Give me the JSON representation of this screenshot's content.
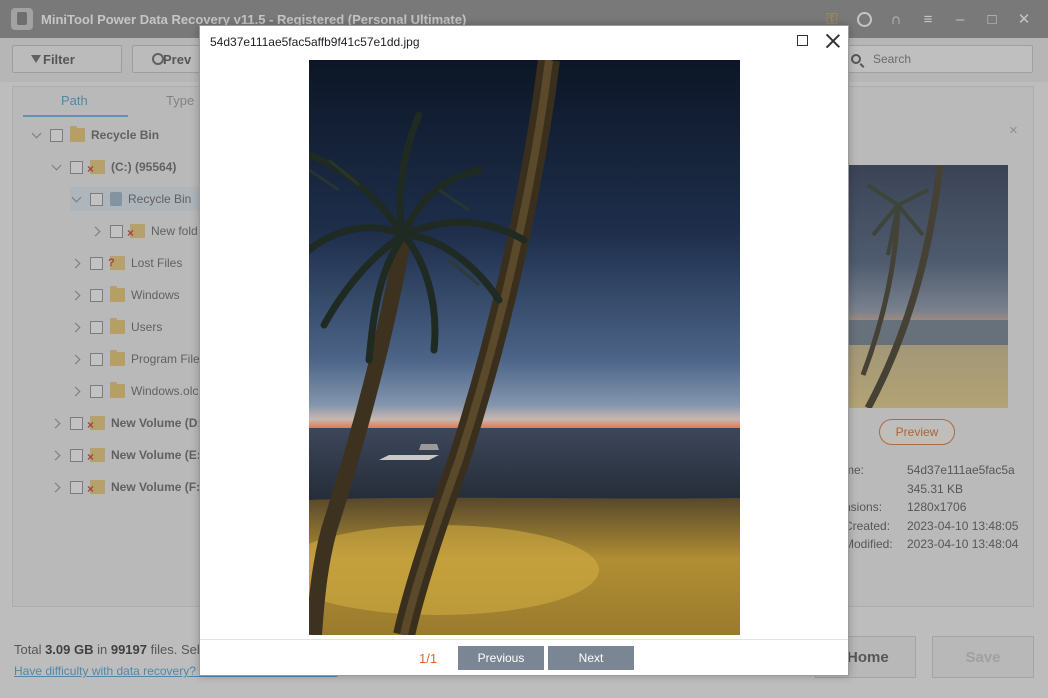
{
  "app": {
    "title": "MiniTool Power Data Recovery v11.5 - Registered (Personal Ultimate)"
  },
  "toolbar": {
    "filter_label": "Filter",
    "preview_label": "Prev",
    "search_placeholder": "Search"
  },
  "tabs": {
    "path": "Path",
    "type": "Type"
  },
  "tree": [
    {
      "label": "Recycle Bin",
      "icon": "folder-icon"
    },
    {
      "label": "(C:) (95564)",
      "icon": "drive-icon"
    },
    {
      "label": "Recycle Bin",
      "icon": "recycle-bin-icon"
    },
    {
      "label": "New fold",
      "icon": "drive-icon"
    },
    {
      "label": "Lost Files",
      "icon": "question-icon"
    },
    {
      "label": "Windows",
      "icon": "folder-icon"
    },
    {
      "label": "Users",
      "icon": "folder-icon"
    },
    {
      "label": "Program File",
      "icon": "folder-icon"
    },
    {
      "label": "Windows.olc",
      "icon": "folder-icon"
    },
    {
      "label": "New Volume (D:",
      "icon": "drive-icon"
    },
    {
      "label": "New Volume (E:)",
      "icon": "drive-icon"
    },
    {
      "label": "New Volume (F:)",
      "icon": "drive-icon"
    }
  ],
  "detail": {
    "close": "×",
    "preview_label": "Preview",
    "rows": [
      {
        "label": "me:",
        "value": "54d37e111ae5fac5a"
      },
      {
        "label": "",
        "value": "345.31 KB"
      },
      {
        "label": "nsions:",
        "value": "1280x1706"
      },
      {
        "label": "Created:",
        "value": "2023-04-10 13:48:05"
      },
      {
        "label": "Modified:",
        "value": "2023-04-10 13:48:04"
      }
    ]
  },
  "bottom": {
    "total_prefix": "Total ",
    "total_size": "3.09 GB",
    "total_mid": " in ",
    "total_files": "99197",
    "total_suffix": " files.  Sele",
    "help_link": "Have difficulty with data recovery? Click here for instructions.",
    "home_label": "Home",
    "save_label": "Save"
  },
  "modal": {
    "filename": "54d37e111ae5fac5affb9f41c57e1dd.jpg",
    "page_counter": "1/1",
    "previous_label": "Previous",
    "next_label": "Next"
  },
  "colors": {
    "accent_blue": "#4fa1d0",
    "accent_orange": "#d9692a",
    "nav_button": "#7b8694",
    "title_bar": "#8b8b8b"
  }
}
